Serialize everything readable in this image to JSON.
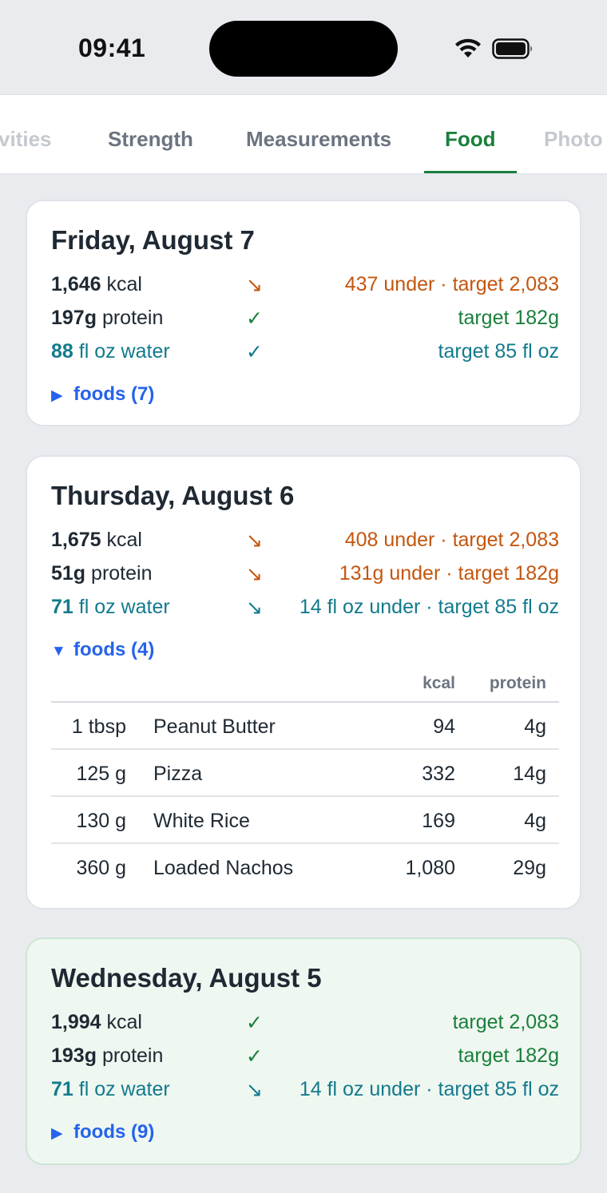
{
  "status_bar": {
    "time": "09:41"
  },
  "tabs": [
    {
      "label": "vities",
      "state": "faded"
    },
    {
      "label": "Strength",
      "state": "normal"
    },
    {
      "label": "Measurements",
      "state": "normal"
    },
    {
      "label": "Food",
      "state": "active"
    },
    {
      "label": "Photo",
      "state": "faded"
    }
  ],
  "colors": {
    "accent_green": "#1a7f3c",
    "under_orange": "#c4560f",
    "water_teal": "#137a8d",
    "link_blue": "#2563eb"
  },
  "days": [
    {
      "title": "Friday, August 7",
      "kcal": {
        "value": "1,646",
        "unit": "kcal",
        "symbol": "↘",
        "note": "437 under · target 2,083",
        "status": "under"
      },
      "protein": {
        "value": "197g",
        "unit": "protein",
        "symbol": "✓",
        "note": "target 182g",
        "status": "met"
      },
      "water": {
        "value": "88",
        "unit": "fl oz water",
        "symbol": "✓",
        "note": "target 85 fl oz",
        "status": "met"
      },
      "foods_label": "foods (7)",
      "foods_expanded": false,
      "foods_toggle_icon": "▶"
    },
    {
      "title": "Thursday, August 6",
      "kcal": {
        "value": "1,675",
        "unit": "kcal",
        "symbol": "↘",
        "note": "408 under · target 2,083",
        "status": "under"
      },
      "protein": {
        "value": "51g",
        "unit": "protein",
        "symbol": "↘",
        "note": "131g under · target 182g",
        "status": "under"
      },
      "water": {
        "value": "71",
        "unit": "fl oz water",
        "symbol": "↘",
        "note": "14 fl oz under · target 85 fl oz",
        "status": "under"
      },
      "foods_label": "foods (4)",
      "foods_expanded": true,
      "foods_toggle_icon": "▼",
      "food_table": {
        "headers": {
          "kcal": "kcal",
          "protein": "protein"
        },
        "rows": [
          {
            "qty": "1 tbsp",
            "name": "Peanut Butter",
            "kcal": "94",
            "protein": "4g"
          },
          {
            "qty": "125 g",
            "name": "Pizza",
            "kcal": "332",
            "protein": "14g"
          },
          {
            "qty": "130 g",
            "name": "White Rice",
            "kcal": "169",
            "protein": "4g"
          },
          {
            "qty": "360 g",
            "name": "Loaded Nachos",
            "kcal": "1,080",
            "protein": "29g"
          }
        ]
      }
    },
    {
      "title": "Wednesday, August 5",
      "kcal": {
        "value": "1,994",
        "unit": "kcal",
        "symbol": "✓",
        "note": "target 2,083",
        "status": "met"
      },
      "protein": {
        "value": "193g",
        "unit": "protein",
        "symbol": "✓",
        "note": "target 182g",
        "status": "met"
      },
      "water": {
        "value": "71",
        "unit": "fl oz water",
        "symbol": "↘",
        "note": "14 fl oz under · target 85 fl oz",
        "status": "under"
      },
      "foods_label": "foods (9)",
      "foods_expanded": false,
      "foods_toggle_icon": "▶"
    }
  ]
}
